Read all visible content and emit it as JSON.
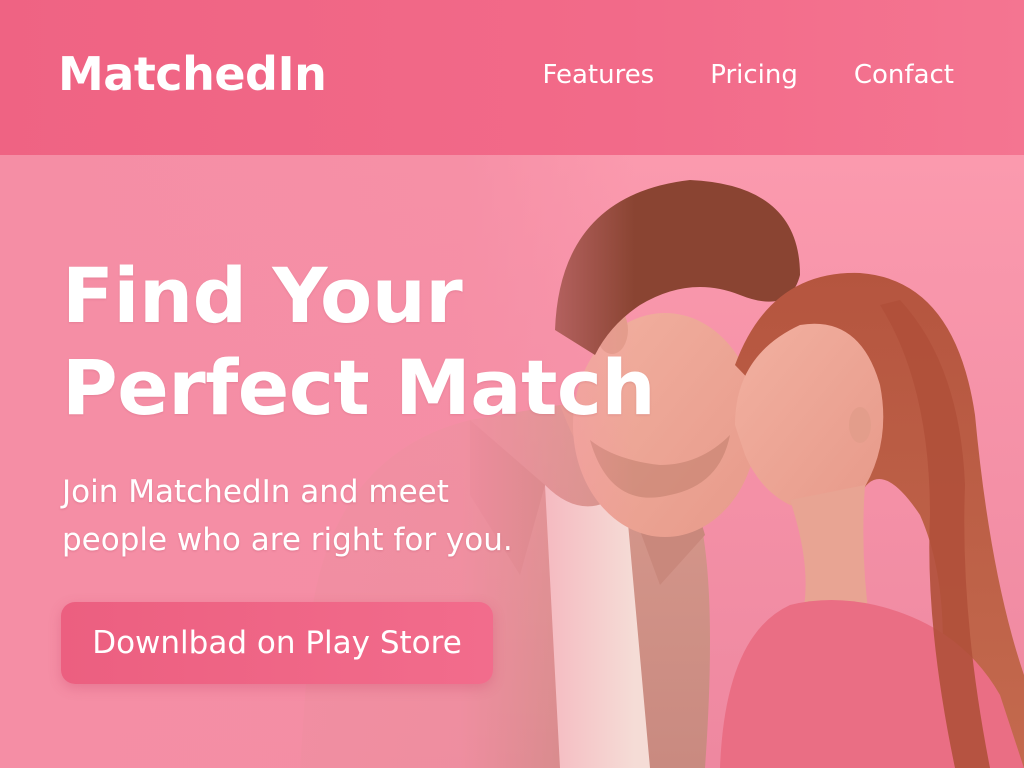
{
  "brand": {
    "logo_text": "MatchedIn"
  },
  "nav": {
    "items": [
      {
        "label": "Features"
      },
      {
        "label": "Pricing"
      },
      {
        "label": "Confact"
      }
    ]
  },
  "hero": {
    "title_line1": "Find Your",
    "title_line2": "Perfect Match",
    "subtitle_line1": "Join MatchedIn and meet",
    "subtitle_line2": "people who are right for you.",
    "cta_label": "Downlbad on Play Store"
  },
  "image": {
    "subject": "couple-photo"
  },
  "colors": {
    "header_bg": "#ef6383",
    "page_bg": "#f98fa7",
    "button_bg": "#ec5f80",
    "text": "#ffffff"
  }
}
